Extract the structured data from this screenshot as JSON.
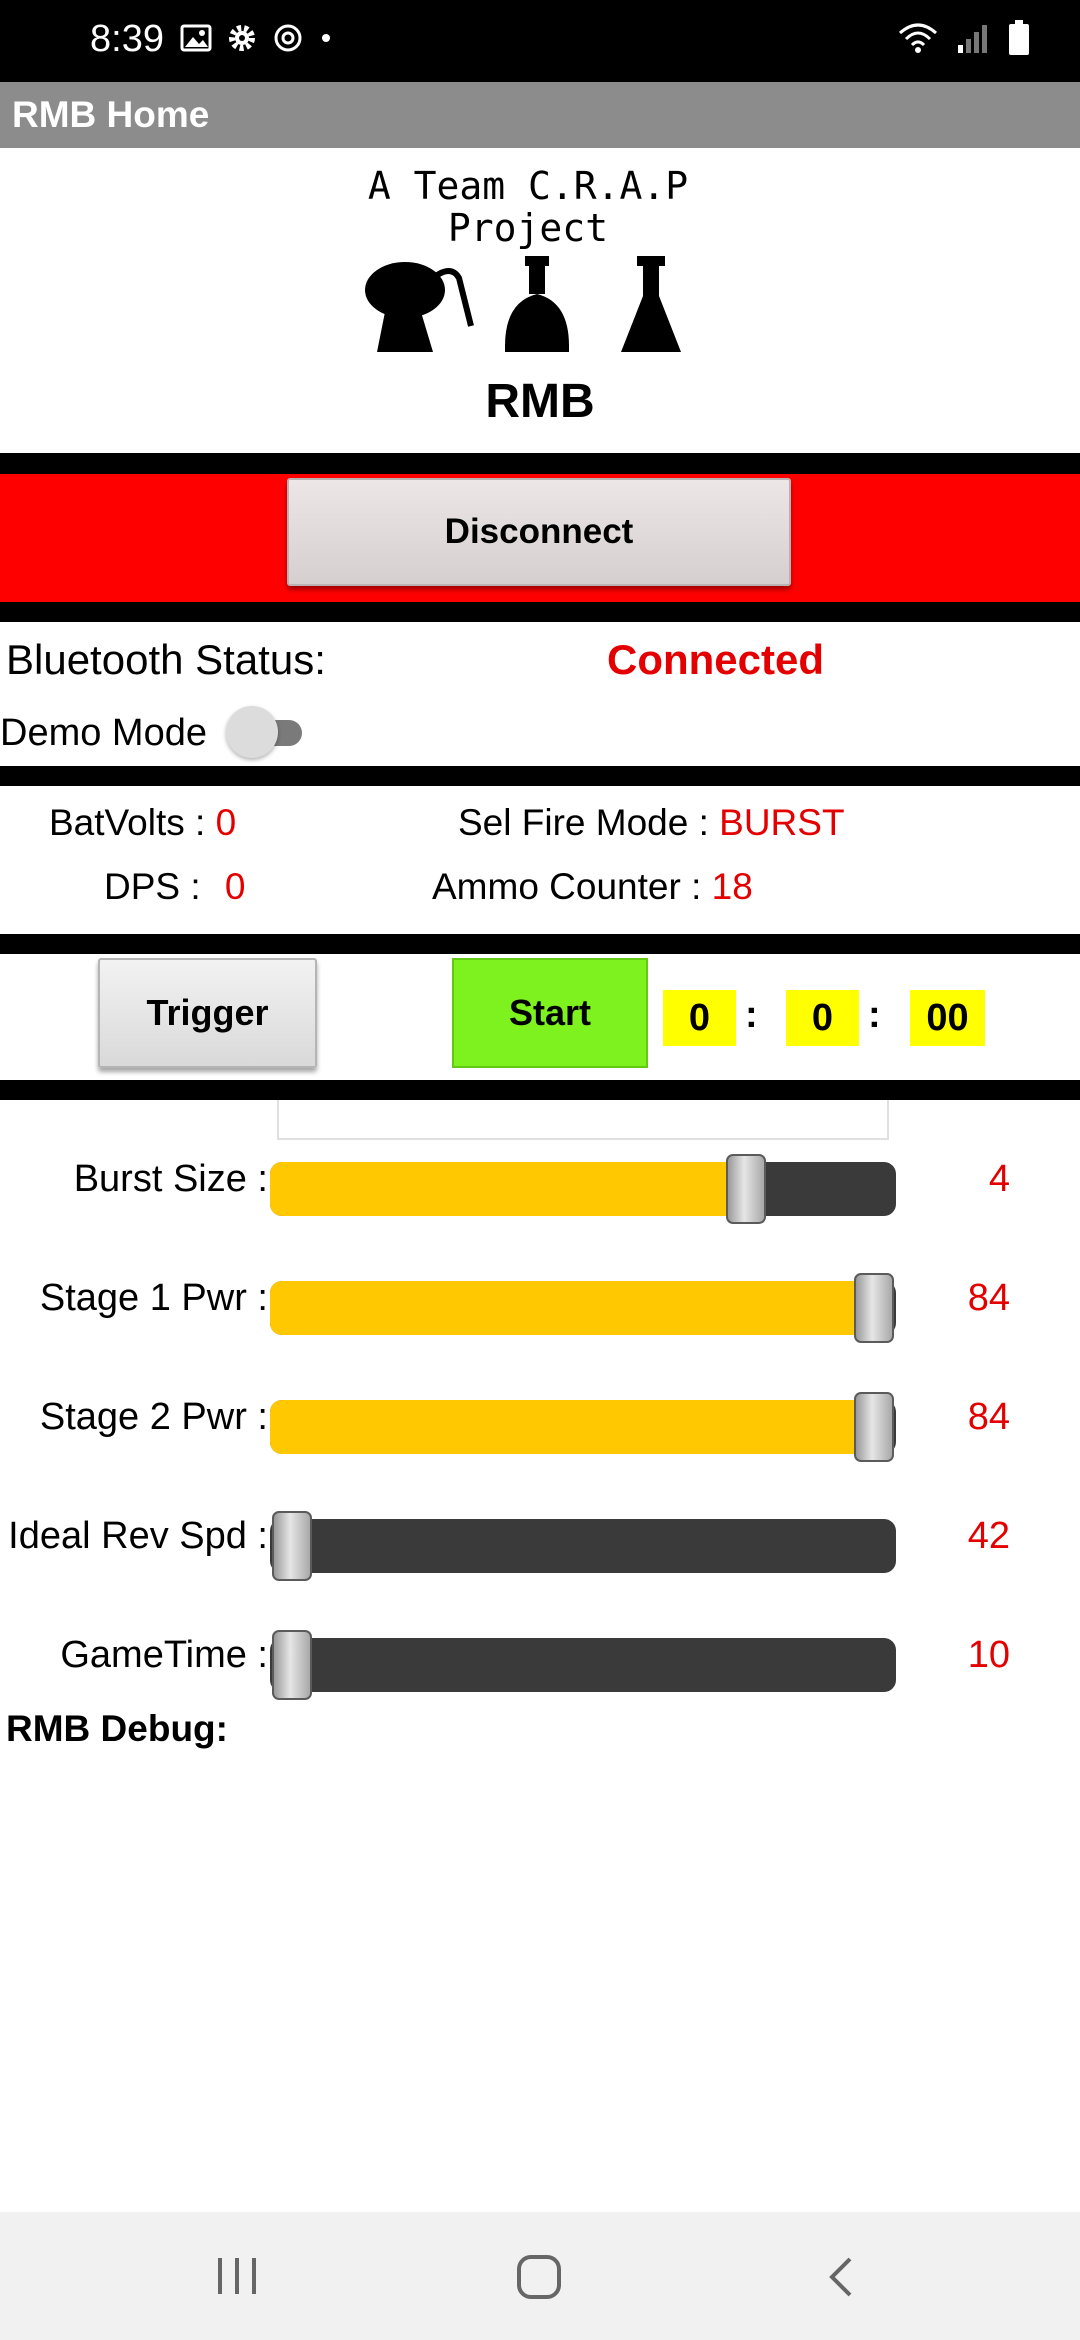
{
  "status_bar": {
    "time": "8:39"
  },
  "title_bar": {
    "title": "RMB Home"
  },
  "logo": {
    "line1": "A Team C.R.A.P",
    "line2": "Project"
  },
  "app_name": "RMB",
  "disconnect_button": "Disconnect",
  "bluetooth": {
    "label": "Bluetooth Status:",
    "value": "Connected"
  },
  "demo_mode": {
    "label": "Demo Mode",
    "enabled": false
  },
  "stats": {
    "batvolts_label": "BatVolts :",
    "batvolts_value": "0",
    "fire_mode_label": "Sel Fire Mode :",
    "fire_mode_value": "BURST",
    "dps_label": "DPS :",
    "dps_value": "0",
    "ammo_label": "Ammo Counter :",
    "ammo_value": "18"
  },
  "controls": {
    "trigger_label": "Trigger",
    "start_label": "Start",
    "timer_h": "0",
    "timer_m": "0",
    "timer_s": "00",
    "sep": ":"
  },
  "sliders": [
    {
      "label": "Burst Size :",
      "value": "4",
      "level": 0.78
    },
    {
      "label": "Stage 1 Pwr :",
      "value": "84",
      "level": 1.0
    },
    {
      "label": "Stage 2 Pwr :",
      "value": "84",
      "level": 1.0
    },
    {
      "label": "Ideal Rev Spd :",
      "value": "42",
      "level": 0.0
    },
    {
      "label": "GameTime :",
      "value": "10",
      "level": 0.0
    }
  ],
  "debug_label": "RMB Debug:",
  "colors": {
    "accent_red": "#e40000",
    "band_red": "#ff0000",
    "slider_fill": "#ffc800",
    "start_green": "#7df21f",
    "timer_yellow": "#ffff00"
  }
}
